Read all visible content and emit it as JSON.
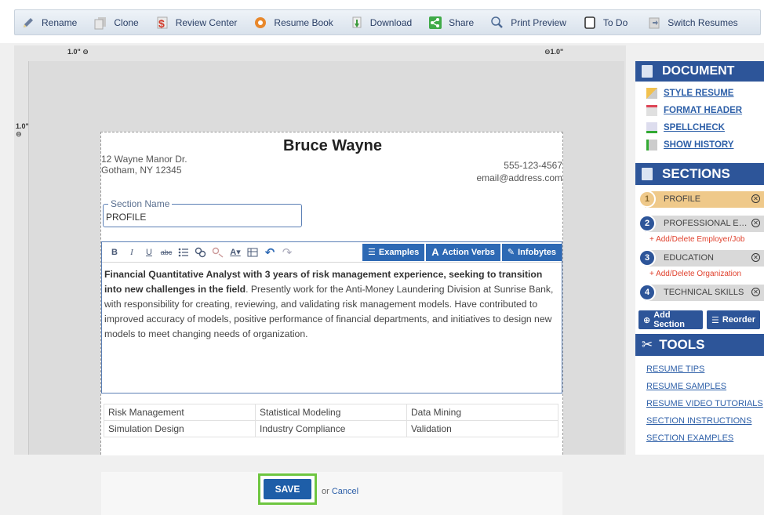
{
  "toolbar": {
    "items": [
      {
        "label": "Rename",
        "icon": "pencil-icon"
      },
      {
        "label": "Clone",
        "icon": "clone-icon"
      },
      {
        "label": "Review Center",
        "icon": "review-center-icon"
      },
      {
        "label": "Resume Book",
        "icon": "resume-book-icon"
      },
      {
        "label": "Download",
        "icon": "download-icon"
      },
      {
        "label": "Share",
        "icon": "share-icon"
      },
      {
        "label": "Print Preview",
        "icon": "print-preview-icon"
      },
      {
        "label": "To Do",
        "icon": "todo-icon"
      },
      {
        "label": "Switch Resumes",
        "icon": "switch-resumes-icon"
      }
    ]
  },
  "rulers": {
    "top_left": "1.0\"",
    "top_right": "1.0\"",
    "left": "1.0\""
  },
  "resume": {
    "name": "Bruce Wayne",
    "address_line1": "12 Wayne Manor Dr.",
    "address_line2": "Gotham, NY 12345",
    "phone": "555-123-4567",
    "email": "email@address.com"
  },
  "editor": {
    "section_name_legend": "Section Name",
    "section_name_value": "PROFILE",
    "buttons": {
      "examples": "Examples",
      "action_verbs": "Action Verbs",
      "infobytes": "Infobytes"
    },
    "summary_bold": "Financial Quantitative Analyst with 3 years of risk management experience, seeking to transition into new challenges in the field",
    "summary_rest": ". Presently work for the Anti-Money Laundering Division at Sunrise Bank, with responsibility for creating, reviewing, and validating risk management models. Have contributed to improved accuracy of models, positive performance of financial departments, and initiatives to design new models to meet changing needs of organization.",
    "skills": [
      [
        "Risk Management",
        "Statistical Modeling",
        "Data Mining"
      ],
      [
        "Simulation Design",
        "Industry Compliance",
        "Validation"
      ]
    ],
    "save_label": "SAVE",
    "or_text": "or",
    "cancel_label": "Cancel"
  },
  "sidebar": {
    "document_title": "DOCUMENT",
    "document_links": [
      "STYLE RESUME",
      "FORMAT HEADER",
      "SPELLCHECK",
      "SHOW HISTORY"
    ],
    "sections_title": "SECTIONS",
    "sections": [
      {
        "num": "1",
        "label": "PROFILE",
        "active": true,
        "sub": ""
      },
      {
        "num": "2",
        "label": "PROFESSIONAL EXP...",
        "active": false,
        "sub": "+ Add/Delete Employer/Job"
      },
      {
        "num": "3",
        "label": "EDUCATION",
        "active": false,
        "sub": "+ Add/Delete Organization"
      },
      {
        "num": "4",
        "label": "TECHNICAL SKILLS",
        "active": false,
        "sub": ""
      }
    ],
    "add_section_label": "Add Section",
    "reorder_label": "Reorder",
    "tools_title": "TOOLS",
    "tool_links": [
      "RESUME TIPS",
      "RESUME SAMPLES",
      "RESUME VIDEO TUTORIALS",
      "SECTION INSTRUCTIONS",
      "SECTION EXAMPLES"
    ]
  },
  "colors": {
    "accent": "#2d5599",
    "active_section": "#efc98a",
    "save_highlight": "#6ec640",
    "add_link": "#e0412d"
  }
}
